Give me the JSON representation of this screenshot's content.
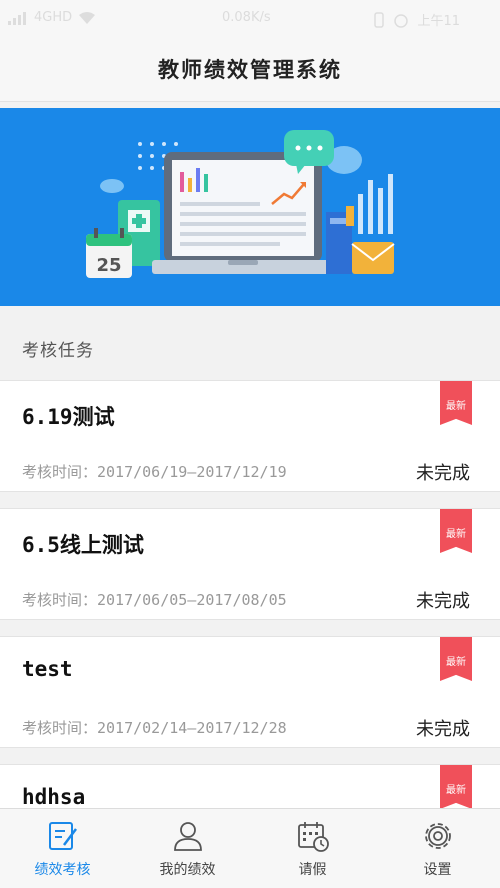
{
  "status_bar": {
    "signal": "4GHD",
    "speed": "0.08K/s",
    "time": "上午11"
  },
  "header": {
    "title": "教师绩效管理系统"
  },
  "banner": {
    "calendar_day": "25"
  },
  "section": {
    "title": "考核任务"
  },
  "tasks": [
    {
      "name": "6.19测试",
      "time": "考核时间：2017/06/19—2017/12/19",
      "status": "未完成",
      "badge": "最新"
    },
    {
      "name": "6.5线上测试",
      "time": "考核时间：2017/06/05—2017/08/05",
      "status": "未完成",
      "badge": "最新"
    },
    {
      "name": "test",
      "time": "考核时间：2017/02/14—2017/12/28",
      "status": "未完成",
      "badge": "最新"
    },
    {
      "name": "hdhsa",
      "time": "",
      "status": "",
      "badge": "最新"
    }
  ],
  "nav": {
    "items": [
      {
        "label": "绩效考核",
        "icon": "edit-icon",
        "active": true
      },
      {
        "label": "我的绩效",
        "icon": "user-icon",
        "active": false
      },
      {
        "label": "请假",
        "icon": "calendar-clock-icon",
        "active": false
      },
      {
        "label": "设置",
        "icon": "gear-icon",
        "active": false
      }
    ]
  },
  "colors": {
    "accent": "#1a88e8",
    "badge": "#f0505a"
  }
}
